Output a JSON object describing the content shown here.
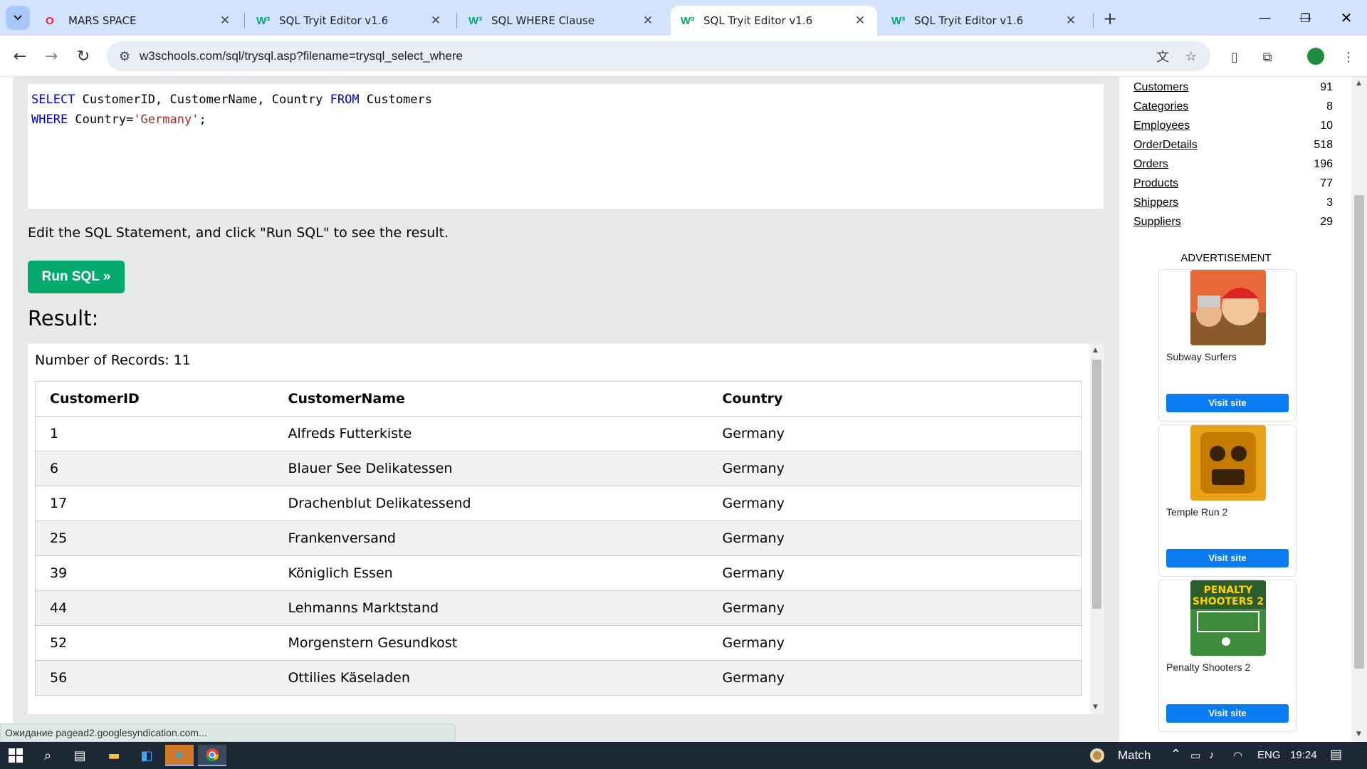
{
  "browser": {
    "tabs": [
      {
        "title": "MARS SPACE",
        "favicon": "O",
        "active": false
      },
      {
        "title": "SQL Tryit Editor v1.6",
        "favicon": "W³",
        "active": false
      },
      {
        "title": "SQL WHERE Clause",
        "favicon": "W³",
        "active": false
      },
      {
        "title": "SQL Tryit Editor v1.6",
        "favicon": "W³",
        "active": true
      },
      {
        "title": "SQL Tryit Editor v1.6",
        "favicon": "W³",
        "active": false
      }
    ],
    "url": "w3schools.com/sql/trysql.asp?filename=trysql_select_where",
    "status_text": "Ожидание pagead2.googlesyndication.com..."
  },
  "editor": {
    "line1": {
      "kw1": "SELECT",
      "mid": " CustomerID, CustomerName, Country ",
      "kw2": "FROM",
      "end": " Customers"
    },
    "line2": {
      "kw": "WHERE",
      "mid": " Country=",
      "str": "'Germany'",
      "end": ";"
    }
  },
  "hint": "Edit the SQL Statement, and click \"Run SQL\" to see the result.",
  "run_button": "Run SQL »",
  "result": {
    "heading": "Result:",
    "record_count": "Number of Records: 11",
    "columns": [
      "CustomerID",
      "CustomerName",
      "Country"
    ],
    "rows": [
      [
        "1",
        "Alfreds Futterkiste",
        "Germany"
      ],
      [
        "6",
        "Blauer See Delikatessen",
        "Germany"
      ],
      [
        "17",
        "Drachenblut Delikatessend",
        "Germany"
      ],
      [
        "25",
        "Frankenversand",
        "Germany"
      ],
      [
        "39",
        "Königlich Essen",
        "Germany"
      ],
      [
        "44",
        "Lehmanns Marktstand",
        "Germany"
      ],
      [
        "52",
        "Morgenstern Gesundkost",
        "Germany"
      ],
      [
        "56",
        "Ottilies Käseladen",
        "Germany"
      ]
    ]
  },
  "sidebar": {
    "tables": [
      {
        "name": "Customers",
        "count": "91"
      },
      {
        "name": "Categories",
        "count": "8"
      },
      {
        "name": "Employees",
        "count": "10"
      },
      {
        "name": "OrderDetails",
        "count": "518"
      },
      {
        "name": "Orders",
        "count": "196"
      },
      {
        "name": "Products",
        "count": "77"
      },
      {
        "name": "Shippers",
        "count": "3"
      },
      {
        "name": "Suppliers",
        "count": "29"
      }
    ],
    "ad_label": "ADVERTISEMENT",
    "ads": [
      {
        "title": "Subway Surfers",
        "button": "Visit site"
      },
      {
        "title": "Temple Run 2",
        "button": "Visit site"
      },
      {
        "title": "Penalty Shooters 2",
        "button": "Visit site"
      }
    ]
  },
  "taskbar": {
    "weather_text": "Match",
    "language": "ENG",
    "time": "19:24"
  }
}
